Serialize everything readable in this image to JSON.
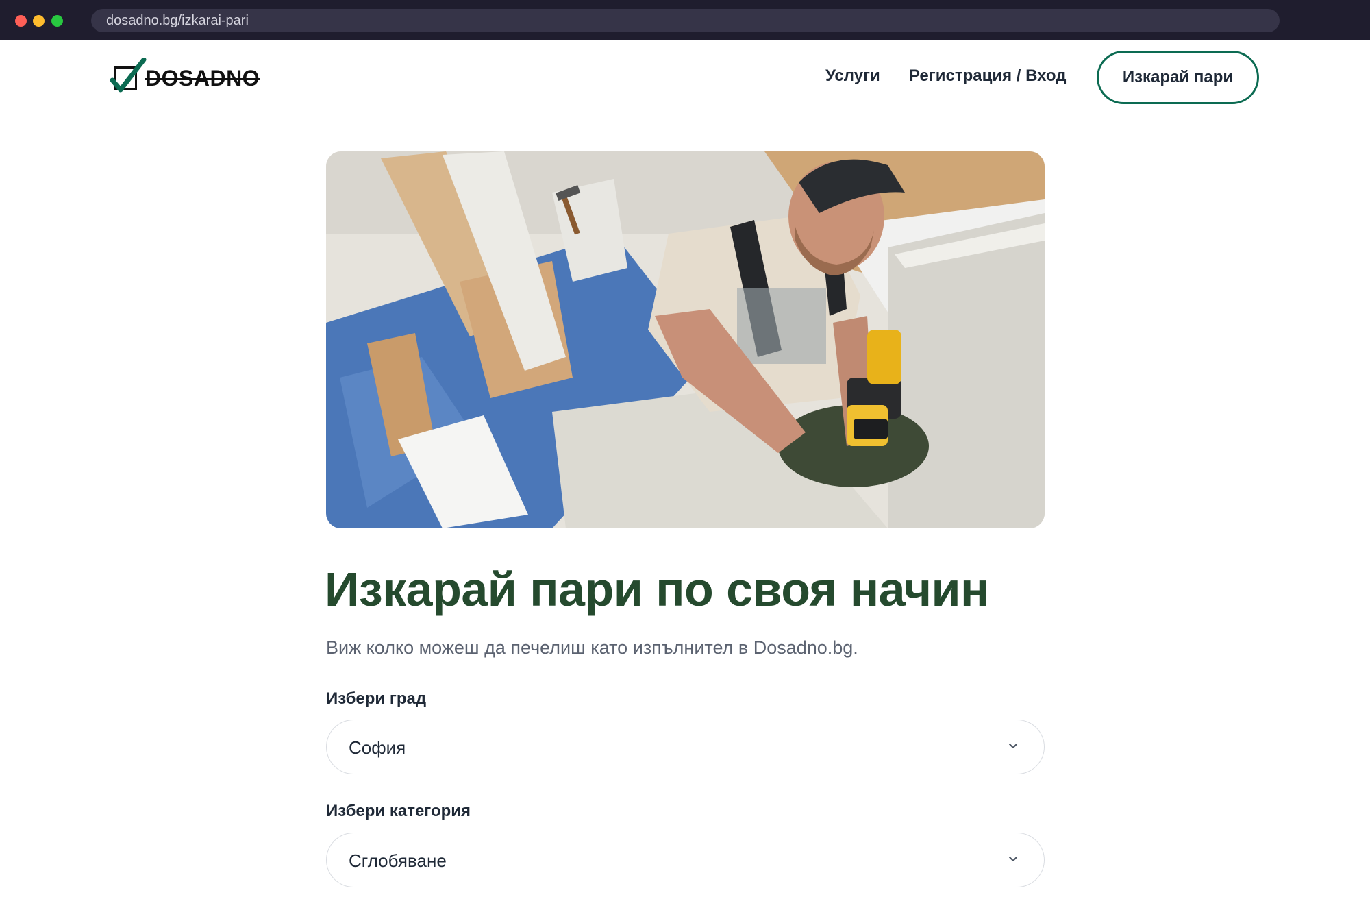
{
  "browser": {
    "url": "dosadno.bg/izkarai-pari"
  },
  "header": {
    "logo_text": "DOSADNO",
    "nav": {
      "services": "Услуги",
      "login": "Регистрация / Вход"
    },
    "cta_label": "Изкарай пари"
  },
  "hero": {
    "image_icon": "worker-assembling-furniture-photo"
  },
  "main": {
    "title": "Изкарай пари по своя начин",
    "subtitle": "Виж колко можеш да печелиш като изпълнител в Dosadno.bg.",
    "city": {
      "label": "Избери град",
      "value": "София"
    },
    "category": {
      "label": "Избери категория",
      "value": "Сглобяване"
    }
  },
  "colors": {
    "brand_green": "#0c6b52",
    "title_green": "#254a2e",
    "chrome_bg": "#1f1d2e"
  }
}
